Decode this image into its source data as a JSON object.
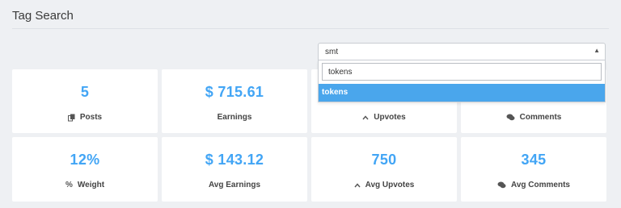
{
  "page": {
    "title": "Tag Search"
  },
  "select": {
    "value": "smt",
    "search_value": "tokens",
    "options": [
      "tokens"
    ]
  },
  "stats": [
    {
      "value": "5",
      "label": "Posts",
      "icon": "files-icon"
    },
    {
      "value": "$ 715.61",
      "label": "Earnings",
      "icon": ""
    },
    {
      "value": "",
      "label": "Upvotes",
      "icon": "chevron-up-icon"
    },
    {
      "value": "",
      "label": "Comments",
      "icon": "comments-icon"
    },
    {
      "value": "12%",
      "label": "Weight",
      "icon": "percent-icon"
    },
    {
      "value": "$ 143.12",
      "label": "Avg Earnings",
      "icon": ""
    },
    {
      "value": "750",
      "label": "Avg Upvotes",
      "icon": "chevron-up-icon"
    },
    {
      "value": "345",
      "label": "Avg Comments",
      "icon": "comments-icon"
    }
  ],
  "colors": {
    "accent": "#42a5f5",
    "highlight": "#4aa6ec",
    "background": "#eef0f3"
  }
}
